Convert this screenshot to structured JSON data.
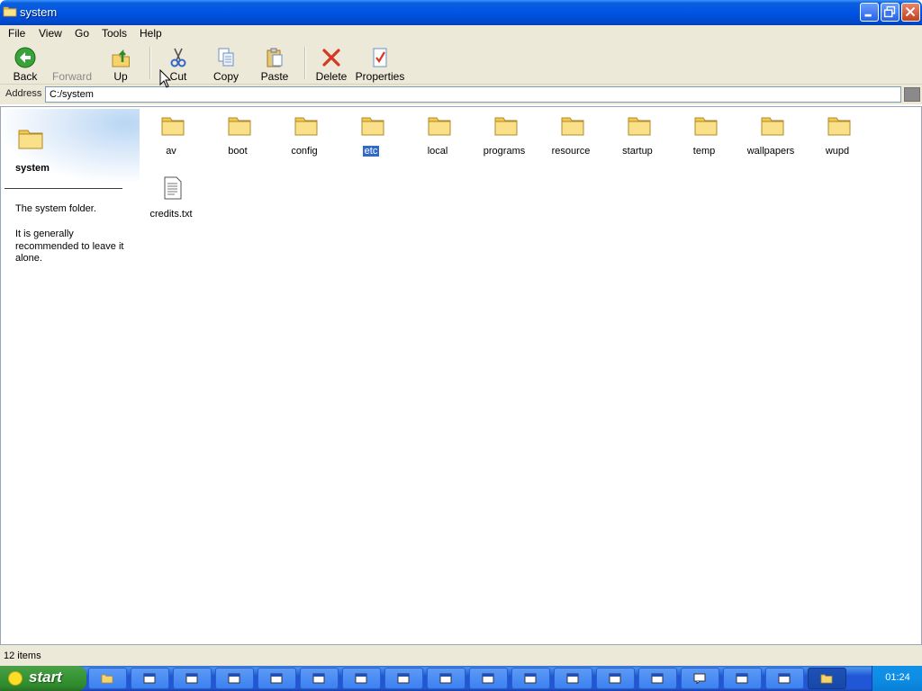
{
  "window": {
    "title": "system"
  },
  "menu": [
    "File",
    "View",
    "Go",
    "Tools",
    "Help"
  ],
  "toolbar": {
    "back": "Back",
    "forward": "Forward",
    "up": "Up",
    "cut": "Cut",
    "copy": "Copy",
    "paste": "Paste",
    "delete": "Delete",
    "properties": "Properties"
  },
  "address": {
    "label": "Address",
    "value": "C:/system"
  },
  "sidebar": {
    "title": "system",
    "description": "The system folder.",
    "note": "It is generally recommended to leave it alone."
  },
  "items": [
    {
      "name": "av",
      "type": "folder",
      "icon": "folder-icon"
    },
    {
      "name": "boot",
      "type": "folder",
      "icon": "folder-icon"
    },
    {
      "name": "config",
      "type": "folder",
      "icon": "folder-icon"
    },
    {
      "name": "etc",
      "type": "folder",
      "icon": "folder-icon",
      "selected": true
    },
    {
      "name": "local",
      "type": "folder",
      "icon": "folder-icon"
    },
    {
      "name": "programs",
      "type": "folder",
      "icon": "folder-icon"
    },
    {
      "name": "resource",
      "type": "folder",
      "icon": "folder-icon"
    },
    {
      "name": "startup",
      "type": "folder",
      "icon": "folder-icon"
    },
    {
      "name": "temp",
      "type": "folder",
      "icon": "folder-icon"
    },
    {
      "name": "wallpapers",
      "type": "folder",
      "icon": "folder-icon"
    },
    {
      "name": "wupd",
      "type": "folder",
      "icon": "folder-icon"
    },
    {
      "name": "credits.txt",
      "type": "file",
      "icon": "text-file-icon"
    }
  ],
  "status": {
    "items_count": "12 items"
  },
  "taskbar": {
    "start_label": "start",
    "clock": "01:24",
    "item_count": 18
  },
  "colors": {
    "accent": "#0054e3",
    "selection": "#316ac5",
    "start_green": "#3c9a3a"
  }
}
